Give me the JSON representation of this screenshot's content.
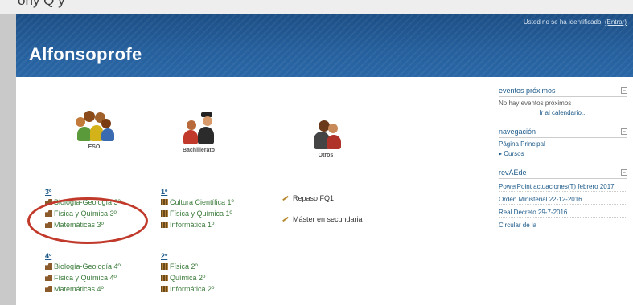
{
  "top_fragment": "ony Q   y",
  "header": {
    "site_title": "Alfonsoprofe",
    "login_text": "Usted no se ha identificado.",
    "login_link": "(Entrar)"
  },
  "icons": [
    {
      "caption": "ESO",
      "icon": "students-group-icon"
    },
    {
      "caption": "Bachillerato",
      "icon": "graduates-icon"
    },
    {
      "caption": "Otros",
      "icon": "teacher-icon"
    }
  ],
  "columns": [
    {
      "level": "3º",
      "items": [
        "Biología-Geología 3º",
        "Física y Química 3º",
        "Matemáticas 3º"
      ]
    },
    {
      "level": "4º",
      "items": [
        "Biología-Geología 4º",
        "Física y Química 4º",
        "Matemáticas 4º"
      ]
    },
    {
      "level": "1º",
      "items": [
        "Cultura Científica 1º",
        "Física y Química 1º",
        "Informática 1º"
      ]
    },
    {
      "level": "2º",
      "items": [
        "Física 2º",
        "Química 2º",
        "Informática 2º"
      ]
    }
  ],
  "misc_links": [
    "Repaso FQ1",
    "Máster en secundaria"
  ],
  "sidebar": {
    "events": {
      "title": "eventos próximos",
      "empty_text": "No hay eventos próximos",
      "calendar_link": "Ir al calendario..."
    },
    "navigation": {
      "title": "navegación",
      "home": "Página Principal",
      "courses": "Cursos"
    },
    "news": {
      "title": "revAEde",
      "entries": [
        "PowerPoint actuaciones(T) febrero 2017",
        "Orden Ministerial 22-12-2016",
        "Real Decreto 29-7-2016",
        "Circular de la"
      ]
    }
  },
  "colors": {
    "banner": "#255f9c",
    "highlight_ring": "#c0392b",
    "link_green": "#3a7a3a",
    "link_blue": "#1d5a8a"
  }
}
